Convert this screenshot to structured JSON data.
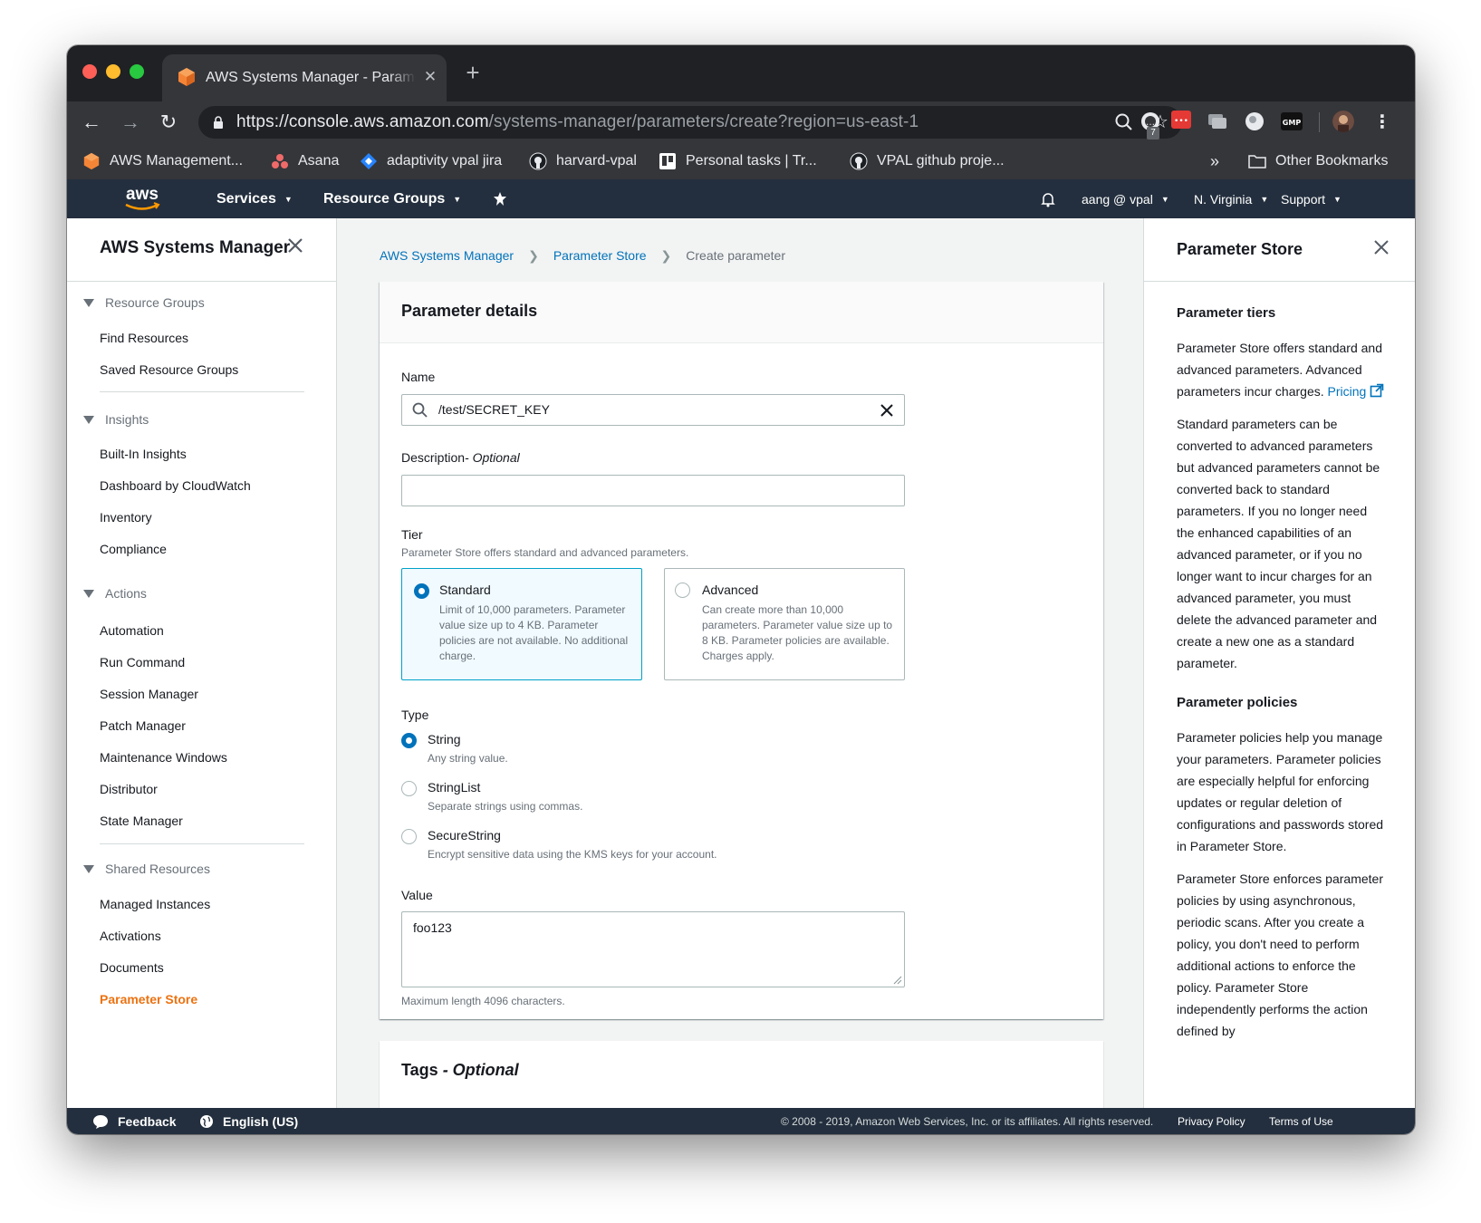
{
  "browser": {
    "tab_title": "AWS Systems Manager - Parameter Store",
    "url_host": "https://console.aws.amazon.com",
    "url_path": "/systems-manager/parameters/create?region=us-east-1",
    "extension_badge": "7",
    "bookmarks": [
      {
        "label": "AWS Management...",
        "icon": "aws-cube-icon"
      },
      {
        "label": "Asana",
        "icon": "asana-icon"
      },
      {
        "label": "adaptivity vpal jira",
        "icon": "jira-icon"
      },
      {
        "label": "harvard-vpal",
        "icon": "github-icon"
      },
      {
        "label": "Personal tasks | Tr...",
        "icon": "trello-icon"
      },
      {
        "label": "VPAL github proje...",
        "icon": "github-icon"
      }
    ],
    "other_bookmarks": "Other Bookmarks",
    "more_bookmarks": "»"
  },
  "awsnav": {
    "logo": "aws",
    "services": "Services",
    "resource_groups": "Resource Groups",
    "user": "aang @ vpal",
    "region": "N. Virginia",
    "support": "Support"
  },
  "leftnav": {
    "title": "AWS Systems Manager",
    "sections": [
      {
        "label": "Resource Groups",
        "items": [
          "Find Resources",
          "Saved Resource Groups"
        ]
      },
      {
        "label": "Insights",
        "items": [
          "Built-In Insights",
          "Dashboard by CloudWatch",
          "Inventory",
          "Compliance"
        ]
      },
      {
        "label": "Actions",
        "items": [
          "Automation",
          "Run Command",
          "Session Manager",
          "Patch Manager",
          "Maintenance Windows",
          "Distributor",
          "State Manager"
        ]
      },
      {
        "label": "Shared Resources",
        "items": [
          "Managed Instances",
          "Activations",
          "Documents",
          "Parameter Store"
        ]
      }
    ],
    "active_item": "Parameter Store"
  },
  "breadcrumb": {
    "items": [
      "AWS Systems Manager",
      "Parameter Store"
    ],
    "current": "Create parameter"
  },
  "form": {
    "panel_title": "Parameter details",
    "name_label": "Name",
    "name_value": "/test/SECRET_KEY",
    "description_label": "Description",
    "description_optional": "- Optional",
    "description_value": "",
    "tier_label": "Tier",
    "tier_desc": "Parameter Store offers standard and advanced parameters.",
    "tiers": [
      {
        "name": "Standard",
        "desc": "Limit of 10,000 parameters. Parameter value size up to 4 KB. Parameter policies are not available. No additional charge.",
        "selected": true
      },
      {
        "name": "Advanced",
        "desc": "Can create more than 10,000 parameters. Parameter value size up to 8 KB. Parameter policies are available. Charges apply.",
        "selected": false
      }
    ],
    "type_label": "Type",
    "types": [
      {
        "name": "String",
        "desc": "Any string value.",
        "selected": true
      },
      {
        "name": "StringList",
        "desc": "Separate strings using commas.",
        "selected": false
      },
      {
        "name": "SecureString",
        "desc": "Encrypt sensitive data using the KMS keys for your account.",
        "selected": false
      }
    ],
    "value_label": "Value",
    "value_text": "foo123",
    "value_hint": "Maximum length 4096 characters.",
    "tags_title": "Tags",
    "tags_optional": " - Optional"
  },
  "help": {
    "title": "Parameter Store",
    "tiers_heading": "Parameter tiers",
    "tiers_p1": "Parameter Store offers standard and advanced parameters. Advanced parameters incur charges.",
    "pricing_link": "Pricing",
    "tiers_p2": "Standard parameters can be converted to advanced parameters but advanced parameters cannot be converted back to standard parameters. If you no longer need the enhanced capabilities of an advanced parameter, or if you no longer want to incur charges for an advanced parameter, you must delete the advanced parameter and create a new one as a standard parameter.",
    "policies_heading": "Parameter policies",
    "policies_p1": "Parameter policies help you manage your parameters. Parameter policies are especially helpful for enforcing updates or regular deletion of configurations and passwords stored in Parameter Store.",
    "policies_p2": "Parameter Store enforces parameter policies by using asynchronous, periodic scans. After you create a policy, you don't need to perform additional actions to enforce the policy. Parameter Store independently performs the action defined by"
  },
  "footer": {
    "feedback": "Feedback",
    "language": "English (US)",
    "copyright": "© 2008 - 2019, Amazon Web Services, Inc. or its affiliates. All rights reserved.",
    "privacy": "Privacy Policy",
    "terms": "Terms of Use"
  }
}
